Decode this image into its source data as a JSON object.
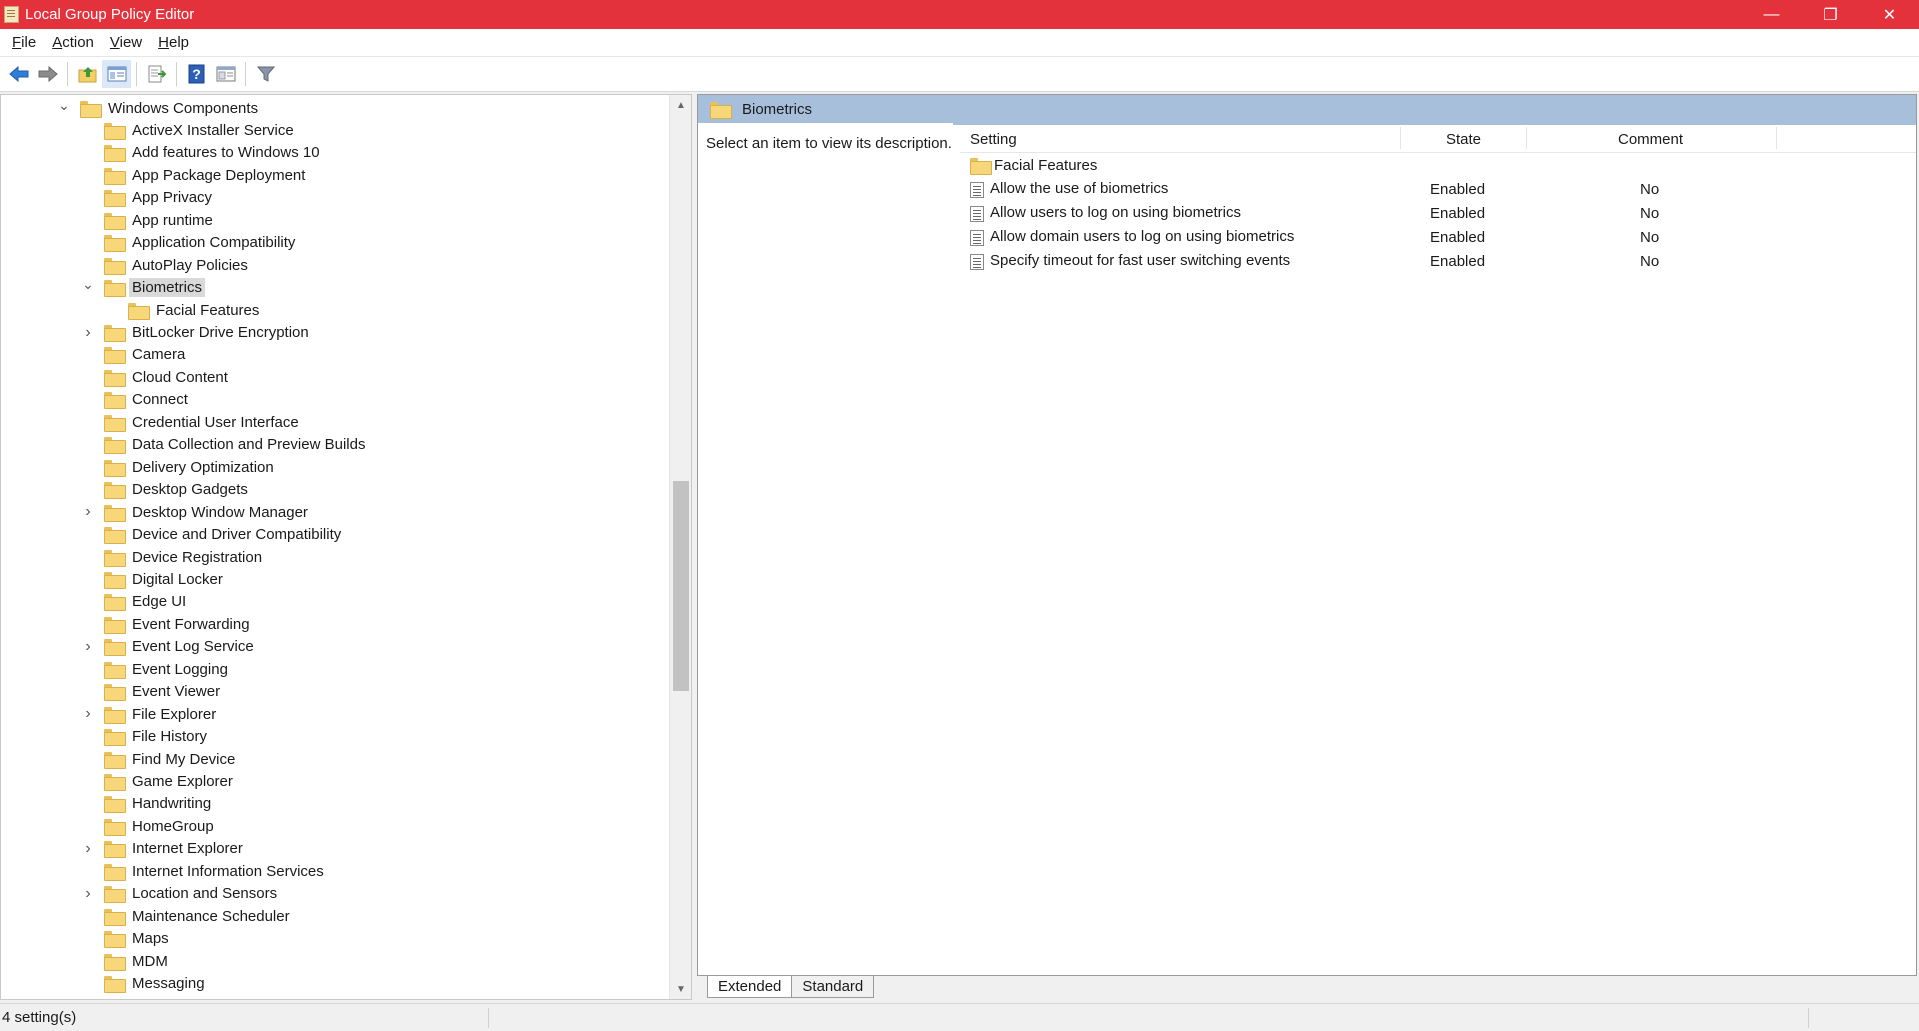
{
  "window": {
    "title": "Local Group Policy Editor",
    "controls": {
      "minimize": "—",
      "maximize": "❐",
      "close": "✕"
    }
  },
  "menu": {
    "items": [
      {
        "label": "File",
        "mnemonic": "F"
      },
      {
        "label": "Action",
        "mnemonic": "A"
      },
      {
        "label": "View",
        "mnemonic": "V"
      },
      {
        "label": "Help",
        "mnemonic": "H"
      }
    ]
  },
  "toolbar": {
    "buttons": [
      "back-icon",
      "forward-icon",
      "up-folder-icon",
      "show-hide-tree-icon",
      "export-list-icon",
      "help-icon",
      "properties-icon",
      "filter-icon"
    ]
  },
  "tree": {
    "items": [
      {
        "label": "Windows Components",
        "level": 0,
        "expander": "open",
        "selected": false
      },
      {
        "label": "ActiveX Installer Service",
        "level": 1,
        "expander": "none",
        "selected": false
      },
      {
        "label": "Add features to Windows 10",
        "level": 1,
        "expander": "none",
        "selected": false
      },
      {
        "label": "App Package Deployment",
        "level": 1,
        "expander": "none",
        "selected": false
      },
      {
        "label": "App Privacy",
        "level": 1,
        "expander": "none",
        "selected": false
      },
      {
        "label": "App runtime",
        "level": 1,
        "expander": "none",
        "selected": false
      },
      {
        "label": "Application Compatibility",
        "level": 1,
        "expander": "none",
        "selected": false
      },
      {
        "label": "AutoPlay Policies",
        "level": 1,
        "expander": "none",
        "selected": false
      },
      {
        "label": "Biometrics",
        "level": 1,
        "expander": "open",
        "selected": true
      },
      {
        "label": "Facial Features",
        "level": 2,
        "expander": "none",
        "selected": false
      },
      {
        "label": "BitLocker Drive Encryption",
        "level": 1,
        "expander": "closed",
        "selected": false
      },
      {
        "label": "Camera",
        "level": 1,
        "expander": "none",
        "selected": false
      },
      {
        "label": "Cloud Content",
        "level": 1,
        "expander": "none",
        "selected": false
      },
      {
        "label": "Connect",
        "level": 1,
        "expander": "none",
        "selected": false
      },
      {
        "label": "Credential User Interface",
        "level": 1,
        "expander": "none",
        "selected": false
      },
      {
        "label": "Data Collection and Preview Builds",
        "level": 1,
        "expander": "none",
        "selected": false
      },
      {
        "label": "Delivery Optimization",
        "level": 1,
        "expander": "none",
        "selected": false
      },
      {
        "label": "Desktop Gadgets",
        "level": 1,
        "expander": "none",
        "selected": false
      },
      {
        "label": "Desktop Window Manager",
        "level": 1,
        "expander": "closed",
        "selected": false
      },
      {
        "label": "Device and Driver Compatibility",
        "level": 1,
        "expander": "none",
        "selected": false
      },
      {
        "label": "Device Registration",
        "level": 1,
        "expander": "none",
        "selected": false
      },
      {
        "label": "Digital Locker",
        "level": 1,
        "expander": "none",
        "selected": false
      },
      {
        "label": "Edge UI",
        "level": 1,
        "expander": "none",
        "selected": false
      },
      {
        "label": "Event Forwarding",
        "level": 1,
        "expander": "none",
        "selected": false
      },
      {
        "label": "Event Log Service",
        "level": 1,
        "expander": "closed",
        "selected": false
      },
      {
        "label": "Event Logging",
        "level": 1,
        "expander": "none",
        "selected": false
      },
      {
        "label": "Event Viewer",
        "level": 1,
        "expander": "none",
        "selected": false
      },
      {
        "label": "File Explorer",
        "level": 1,
        "expander": "closed",
        "selected": false
      },
      {
        "label": "File History",
        "level": 1,
        "expander": "none",
        "selected": false
      },
      {
        "label": "Find My Device",
        "level": 1,
        "expander": "none",
        "selected": false
      },
      {
        "label": "Game Explorer",
        "level": 1,
        "expander": "none",
        "selected": false
      },
      {
        "label": "Handwriting",
        "level": 1,
        "expander": "none",
        "selected": false
      },
      {
        "label": "HomeGroup",
        "level": 1,
        "expander": "none",
        "selected": false
      },
      {
        "label": "Internet Explorer",
        "level": 1,
        "expander": "closed",
        "selected": false
      },
      {
        "label": "Internet Information Services",
        "level": 1,
        "expander": "none",
        "selected": false
      },
      {
        "label": "Location and Sensors",
        "level": 1,
        "expander": "closed",
        "selected": false
      },
      {
        "label": "Maintenance Scheduler",
        "level": 1,
        "expander": "none",
        "selected": false
      },
      {
        "label": "Maps",
        "level": 1,
        "expander": "none",
        "selected": false
      },
      {
        "label": "MDM",
        "level": 1,
        "expander": "none",
        "selected": false
      },
      {
        "label": "Messaging",
        "level": 1,
        "expander": "none",
        "selected": false
      }
    ]
  },
  "details": {
    "header_title": "Biometrics",
    "description": "Select an item to view its description.",
    "columns": {
      "setting": "Setting",
      "state": "State",
      "comment": "Comment"
    },
    "rows": [
      {
        "type": "folder",
        "setting": "Facial Features",
        "state": "",
        "comment": ""
      },
      {
        "type": "policy",
        "setting": "Allow the use of biometrics",
        "state": "Enabled",
        "comment": "No"
      },
      {
        "type": "policy",
        "setting": "Allow users to log on using biometrics",
        "state": "Enabled",
        "comment": "No"
      },
      {
        "type": "policy",
        "setting": "Allow domain users to log on using biometrics",
        "state": "Enabled",
        "comment": "No"
      },
      {
        "type": "policy",
        "setting": "Specify timeout for fast user switching events",
        "state": "Enabled",
        "comment": "No"
      }
    ],
    "tabs": [
      {
        "label": "Extended",
        "active": true
      },
      {
        "label": "Standard",
        "active": false
      }
    ]
  },
  "status": {
    "text": "4 setting(s)"
  },
  "colors": {
    "titlebar": "#e3323b",
    "header": "#a8bfdc",
    "selection": "#d9d9d9"
  }
}
